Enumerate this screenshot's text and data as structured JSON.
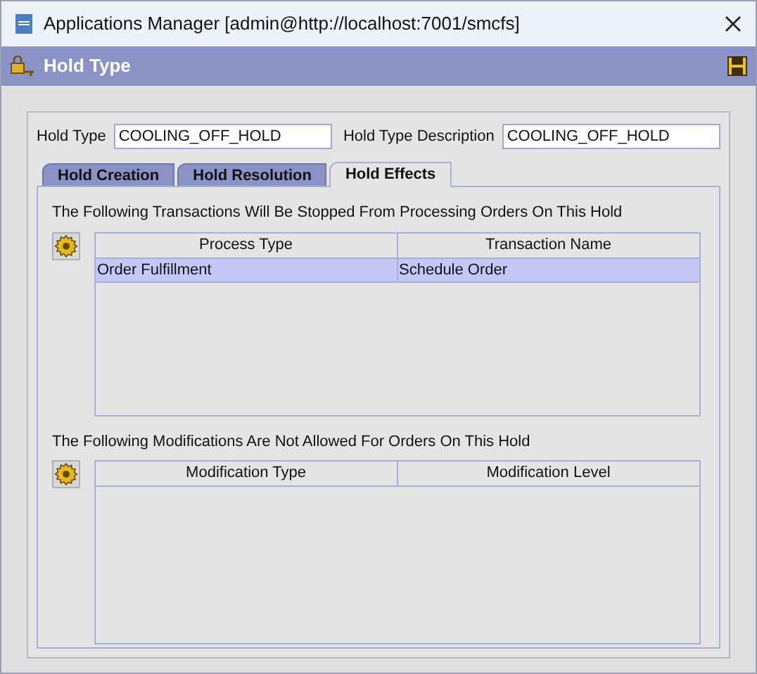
{
  "window": {
    "title": "Applications Manager [admin@http://localhost:7001/smcfs]"
  },
  "header": {
    "title": "Hold Type"
  },
  "fields": [
    {
      "label": "Hold Type",
      "value": "COOLING_OFF_HOLD"
    },
    {
      "label": "Hold Type Description",
      "value": "COOLING_OFF_HOLD"
    }
  ],
  "tabs": [
    {
      "label": "Hold Creation",
      "selected": false
    },
    {
      "label": "Hold Resolution",
      "selected": false
    },
    {
      "label": "Hold Effects",
      "selected": true
    }
  ],
  "sections": [
    {
      "caption": "The Following Transactions Will Be Stopped From Processing Orders On This Hold",
      "columns": [
        "Process Type",
        "Transaction Name"
      ],
      "rows": [
        {
          "cells": [
            "Order Fulfillment",
            "Schedule Order"
          ],
          "selected": true
        }
      ]
    },
    {
      "caption": "The Following Modifications Are Not Allowed For Orders On This Hold",
      "columns": [
        "Modification Type",
        "Modification Level"
      ]
    }
  ]
}
